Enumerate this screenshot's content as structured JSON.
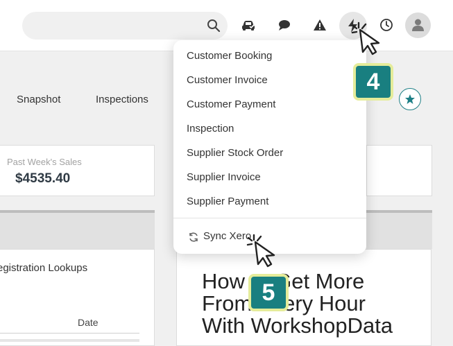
{
  "topbar": {
    "search": {
      "placeholder": ""
    },
    "icons": [
      "search-icon",
      "car-icon",
      "chat-icon",
      "warning-icon",
      "bolt-icon",
      "clock-icon",
      "user-icon"
    ]
  },
  "nav": {
    "tabs": [
      {
        "label": "Snapshot"
      },
      {
        "label": "Inspections"
      }
    ]
  },
  "dashboard": {
    "sales_label": "Past Week's Sales",
    "sales_value": "$4535.40",
    "rego_heading": "egistration Lookups",
    "date_header": "Date",
    "headline": "How to Get More\nFrom Every Hour\nWith WorkshopData"
  },
  "quick_create_menu": {
    "items": [
      {
        "label": "Customer Booking"
      },
      {
        "label": "Customer Invoice"
      },
      {
        "label": "Customer Payment"
      },
      {
        "label": "Inspection"
      },
      {
        "label": "Supplier Stock Order"
      },
      {
        "label": "Supplier Invoice"
      },
      {
        "label": "Supplier Payment"
      }
    ],
    "sync": {
      "label": "Sync Xero",
      "icon": "refresh-icon"
    }
  },
  "tutorial": {
    "steps": [
      {
        "number": "4"
      },
      {
        "number": "5"
      }
    ]
  },
  "colors": {
    "accent": "#1d7f86",
    "badge_fill": "#197f80",
    "badge_border": "#e5ec9a",
    "page_bg": "#f0f0f0"
  }
}
